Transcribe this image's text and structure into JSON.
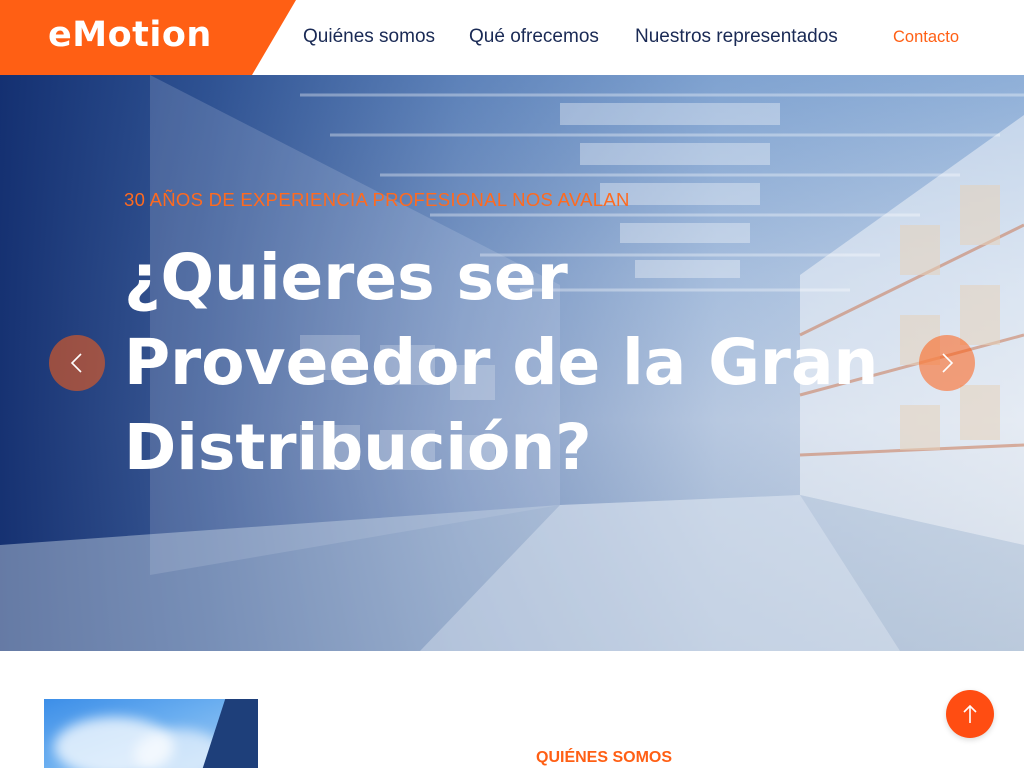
{
  "brand": {
    "name": "eMotion",
    "accent": "#ff5f14",
    "navy": "#1a2a55"
  },
  "nav": {
    "items": [
      {
        "label": "Quiénes somos"
      },
      {
        "label": "Qué ofrecemos"
      },
      {
        "label": "Nuestros representados"
      }
    ],
    "contact_label": "Contacto"
  },
  "hero": {
    "kicker": "30 AÑOS DE EXPERIENCIA PROFESIONAL NOS AVALAN",
    "title": "¿Quieres ser Proveedor de la Gran Distribución?",
    "prev_icon": "chevron-left-icon",
    "next_icon": "chevron-right-icon"
  },
  "about": {
    "section_label": "QUIÉNES SOMOS"
  },
  "scroll_top": {
    "icon": "arrow-up-icon"
  }
}
